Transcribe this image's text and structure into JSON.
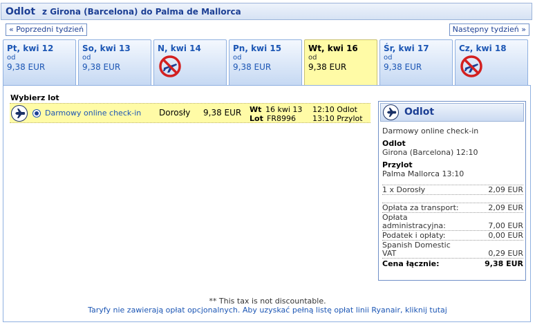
{
  "header": {
    "title": "Odlot",
    "route": "z Girona (Barcelona) do Palma de Mallorca"
  },
  "nav": {
    "prev_week": "« Poprzedni tydzień",
    "next_week": "Następny tydzień »"
  },
  "days": [
    {
      "label": "Pt, kwi 12",
      "from": "od",
      "price": "9,38 EUR",
      "available": true,
      "selected": false
    },
    {
      "label": "So, kwi 13",
      "from": "od",
      "price": "9,38 EUR",
      "available": true,
      "selected": false
    },
    {
      "label": "N, kwi 14",
      "from": "",
      "price": "",
      "available": false,
      "selected": false
    },
    {
      "label": "Pn, kwi 15",
      "from": "od",
      "price": "9,38 EUR",
      "available": true,
      "selected": false
    },
    {
      "label": "Wt, kwi 16",
      "from": "od",
      "price": "9,38 EUR",
      "available": true,
      "selected": true
    },
    {
      "label": "Śr, kwi 17",
      "from": "od",
      "price": "9,38 EUR",
      "available": true,
      "selected": false
    },
    {
      "label": "Cz, kwi 18",
      "from": "",
      "price": "",
      "available": false,
      "selected": false
    }
  ],
  "selection": {
    "title": "Wybierz lot",
    "flight": {
      "fare": "Darmowy online check-in",
      "passenger": "Dorosły",
      "price": "9,38 EUR",
      "date_key": "Wt",
      "date": "16 kwi 13",
      "flight_key": "Lot",
      "flight_no": "FR8996",
      "departure": "12:10 Odlot",
      "arrival": "13:10 Przylot"
    }
  },
  "summary": {
    "title": "Odlot",
    "fare": "Darmowy online check-in",
    "dep_label": "Odlot",
    "dep_value": "Girona (Barcelona) 12:10",
    "arr_label": "Przylot",
    "arr_value": "Palma Mallorca 13:10",
    "pax_line": {
      "label": "1 x Dorosły",
      "value": "2,09 EUR"
    },
    "costs": [
      {
        "label": "Opłata za transport:",
        "value": "2,09 EUR"
      },
      {
        "label": "Opłata administracyjna:",
        "value": "7,00 EUR"
      },
      {
        "label": "Podatek i opłaty:",
        "value": "0,00 EUR"
      },
      {
        "label": "Spanish Domestic VAT",
        "value": "0,29 EUR"
      }
    ],
    "total": {
      "label": "Cena łącznie:",
      "value": "9,38 EUR"
    }
  },
  "footer": {
    "tax_note": "** This tax is not discountable.",
    "fees_link": "Taryfy nie zawierają opłat opcjonalnych. Aby uzyskać pełną listę opłat linii Ryanair, kliknij tutaj"
  },
  "colors": {
    "accent": "#1c56b4",
    "selected_day": "#fffba6",
    "no_flight": "#d32020"
  }
}
